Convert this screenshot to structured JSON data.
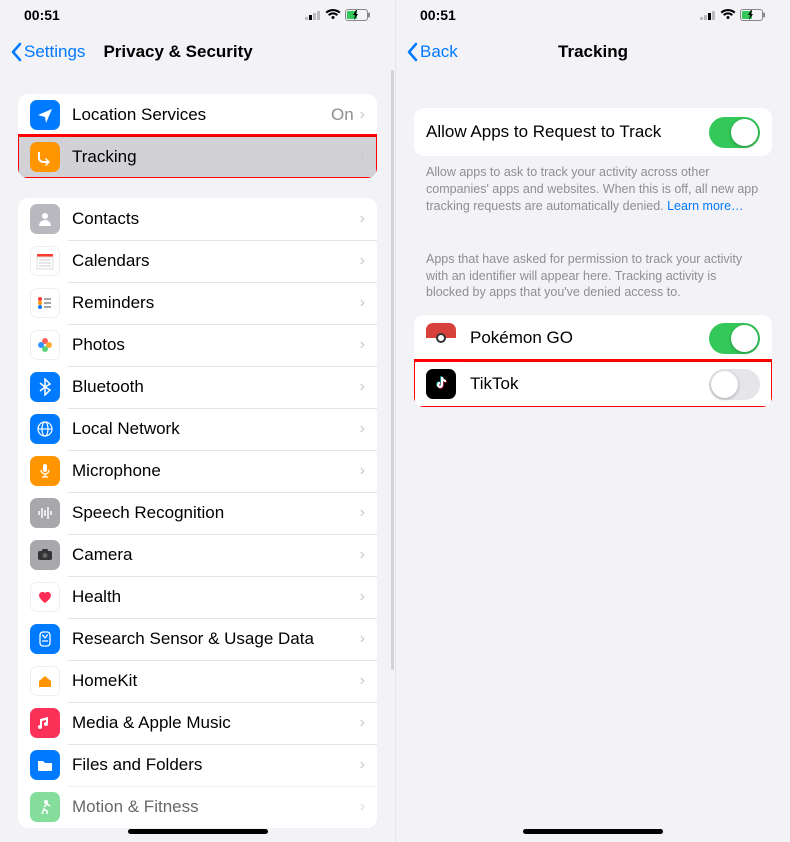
{
  "left": {
    "time": "00:51",
    "back_label": "Settings",
    "title": "Privacy & Security",
    "group1": [
      {
        "label": "Location Services",
        "value": "On",
        "icon_bg": "#007aff"
      },
      {
        "label": "Tracking",
        "value": "",
        "icon_bg": "#ff9500"
      }
    ],
    "group2": [
      {
        "label": "Contacts",
        "icon_bg": "#b8b8be"
      },
      {
        "label": "Calendars",
        "icon_bg": "#ffffff"
      },
      {
        "label": "Reminders",
        "icon_bg": "#ffffff"
      },
      {
        "label": "Photos",
        "icon_bg": "#ffffff"
      },
      {
        "label": "Bluetooth",
        "icon_bg": "#007aff"
      },
      {
        "label": "Local Network",
        "icon_bg": "#007aff"
      },
      {
        "label": "Microphone",
        "icon_bg": "#ff9500"
      },
      {
        "label": "Speech Recognition",
        "icon_bg": "#a7a7ac"
      },
      {
        "label": "Camera",
        "icon_bg": "#a7a7ac"
      },
      {
        "label": "Health",
        "icon_bg": "#ffffff"
      },
      {
        "label": "Research Sensor & Usage Data",
        "icon_bg": "#007aff"
      },
      {
        "label": "HomeKit",
        "icon_bg": "#ffffff"
      },
      {
        "label": "Media & Apple Music",
        "icon_bg": "#fc3158"
      },
      {
        "label": "Files and Folders",
        "icon_bg": "#007aff"
      },
      {
        "label": "Motion & Fitness",
        "icon_bg": "#34c759"
      }
    ]
  },
  "right": {
    "time": "00:51",
    "back_label": "Back",
    "title": "Tracking",
    "allow_label": "Allow Apps to Request to Track",
    "allow_on": true,
    "desc1": "Allow apps to ask to track your activity across other companies' apps and websites. When this is off, all new app tracking requests are automatically denied. ",
    "learn_more": "Learn more…",
    "desc2": "Apps that have asked for permission to track your activity with an identifier will appear here. Tracking activity is blocked by apps that you've denied access to.",
    "apps": [
      {
        "label": "Pokémon GO",
        "on": true
      },
      {
        "label": "TikTok",
        "on": false
      }
    ]
  }
}
